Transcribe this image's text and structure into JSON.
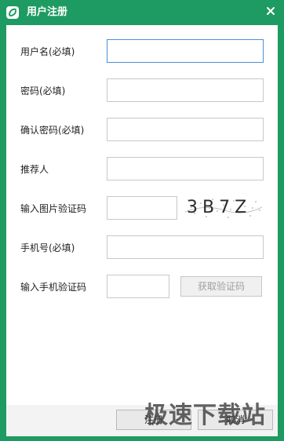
{
  "window": {
    "title": "用户注册",
    "icon": "app-logo-icon",
    "accent": "#1e9b62"
  },
  "form": {
    "fields": [
      {
        "label": "用户名(必填)",
        "value": ""
      },
      {
        "label": "密码(必填)",
        "value": ""
      },
      {
        "label": "确认密码(必填)",
        "value": ""
      },
      {
        "label": "推荐人",
        "value": ""
      },
      {
        "label": "输入图片验证码",
        "value": ""
      },
      {
        "label": "手机号(必填)",
        "value": ""
      },
      {
        "label": "输入手机验证码",
        "value": ""
      }
    ],
    "captcha_text": "3B7Z",
    "sms_button": "获取验证码"
  },
  "footer": {
    "register": "注册",
    "cancel": "取消"
  },
  "watermark": "极速下载站"
}
